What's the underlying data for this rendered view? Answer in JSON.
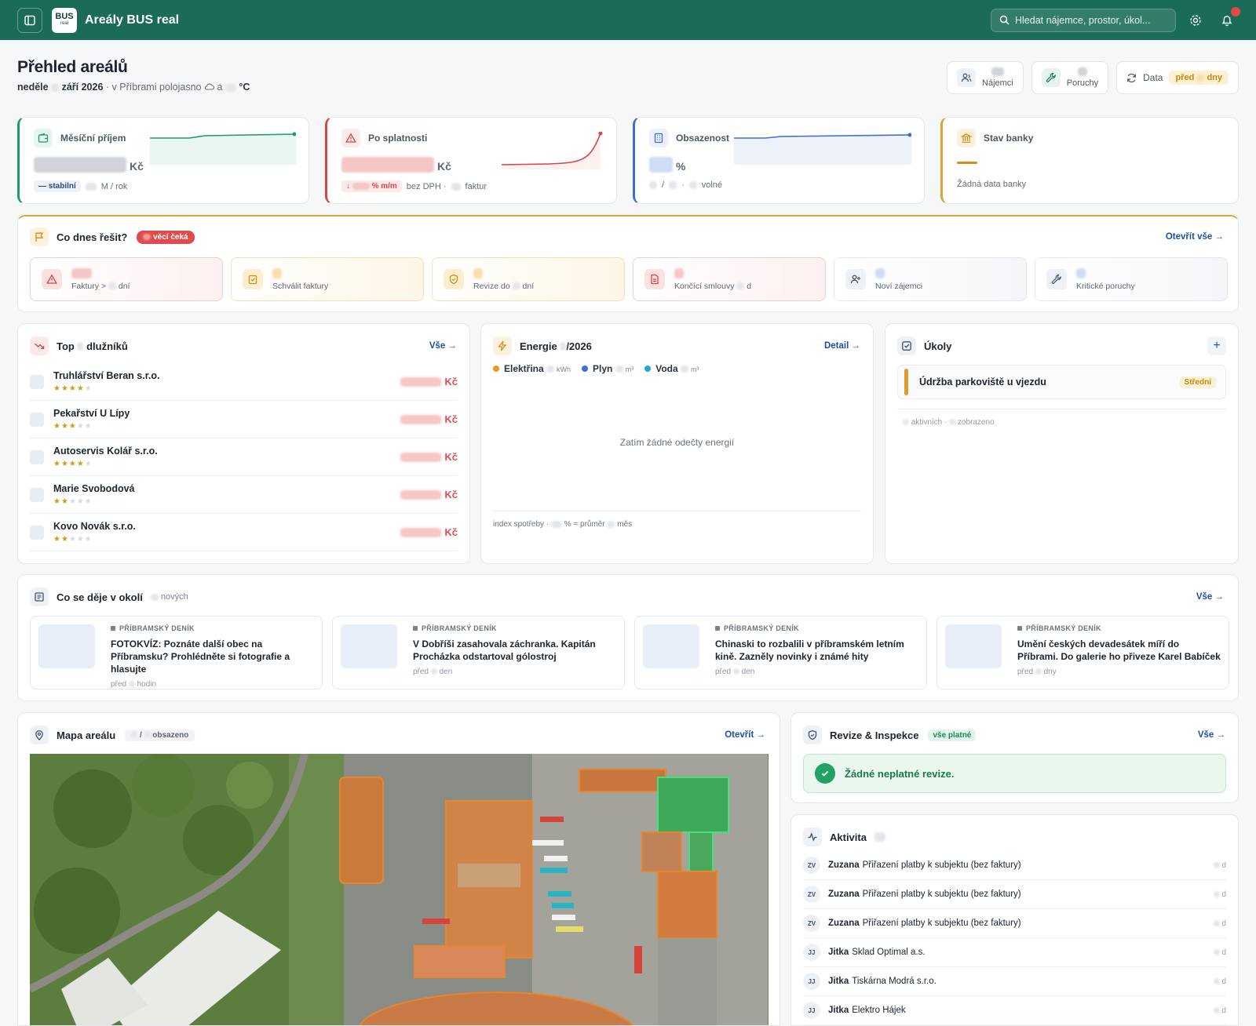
{
  "app": {
    "title": "Areály BUS real",
    "logo_text": "BUS",
    "logo_sub": "real",
    "search_placeholder": "Hledat nájemce, prostor, úkol..."
  },
  "header": {
    "title": "Přehled areálů",
    "date_day": "neděle",
    "date_month": "září 2026",
    "weather_pre": "· v Příbrami polojasno",
    "weather_mid": "a",
    "weather_unit": "°C"
  },
  "chips": {
    "tenants": "Nájemci",
    "faults": "Poruchy",
    "data_label": "Data",
    "data_pill_a": "před",
    "data_pill_b": "dny"
  },
  "kpis": {
    "income": {
      "label": "Měsíční příjem",
      "unit": "Kč",
      "badge": "stabilní",
      "foot": "M / rok"
    },
    "overdue": {
      "label": "Po splatnosti",
      "unit": "Kč",
      "badge": "% m/m",
      "foot_a": "bez DPH ·",
      "foot_b": "faktur"
    },
    "occupancy": {
      "label": "Obsazenost",
      "unit": "%",
      "foot_a": "/",
      "foot_b": "·",
      "foot_c": "volné"
    },
    "bank": {
      "label": "Stav banky",
      "foot": "Žádná data banky"
    }
  },
  "today": {
    "title": "Co dnes řešit?",
    "badge": "věcí čeká",
    "open_all": "Otevřít vše",
    "tiles": [
      {
        "a": "Faktury >",
        "b": "dní"
      },
      {
        "a": "Schválit faktury",
        "b": ""
      },
      {
        "a": "Revize do",
        "b": "dní"
      },
      {
        "a": "Končící smlouvy",
        "b": "d"
      },
      {
        "a": "Noví zájemci",
        "b": ""
      },
      {
        "a": "Kritické poruchy",
        "b": ""
      }
    ]
  },
  "debtors": {
    "title_a": "Top",
    "title_b": "dlužníků",
    "all": "Vše",
    "currency": "Kč",
    "items": [
      {
        "name": "Truhlářství Beran s.r.o.",
        "stars": 4
      },
      {
        "name": "Pekařství U Lípy",
        "stars": 3
      },
      {
        "name": "Autoservis Kolář s.r.o.",
        "stars": 4
      },
      {
        "name": "Marie Svobodová",
        "stars": 2
      },
      {
        "name": "Kovo Novák s.r.o.",
        "stars": 2
      }
    ]
  },
  "energy": {
    "title_a": "Energie",
    "title_b": "/2026",
    "detail": "Detail",
    "legend": [
      {
        "name": "Elektřina",
        "unit": "kWh",
        "color": "#e59a26"
      },
      {
        "name": "Plyn",
        "unit": "m³",
        "color": "#3c6fd1"
      },
      {
        "name": "Voda",
        "unit": "m³",
        "color": "#2aa6c9"
      }
    ],
    "empty": "Zatím žádné odečty energií",
    "foot_a": "index spotřeby ·",
    "foot_b": "% = průměr",
    "foot_c": "měs"
  },
  "tasks": {
    "title": "Úkoly",
    "item": "Údržba parkoviště u vjezdu",
    "priority": "Střední",
    "foot_a": "aktivních ·",
    "foot_b": "zobrazeno"
  },
  "news": {
    "title": "Co se děje v okolí",
    "count": "nových",
    "all": "Vše",
    "items": [
      {
        "source": "PŘÍBRAMSKÝ DENÍK",
        "headline": "FOTOKVÍZ: Poznáte další obec na Příbramsku? Prohlédněte si fotografie a hlasujte",
        "t1": "před",
        "t2": "hodin"
      },
      {
        "source": "PŘÍBRAMSKÝ DENÍK",
        "headline": "V Dobříši zasahovala záchranka. Kapitán Procházka odstartoval gólostroj",
        "t1": "před",
        "t2": "den"
      },
      {
        "source": "PŘÍBRAMSKÝ DENÍK",
        "headline": "Chinaski to rozbalili v příbramském letním kině. Zazněly novinky i známé hity",
        "t1": "před",
        "t2": "den"
      },
      {
        "source": "PŘÍBRAMSKÝ DENÍK",
        "headline": "Umění českých devadesátek míří do Příbrami. Do galerie ho přiveze Karel Babíček",
        "t1": "před",
        "t2": "dny"
      }
    ]
  },
  "map": {
    "title": "Mapa areálu",
    "sep": "/",
    "occupied": "obsazeno",
    "open": "Otevřít"
  },
  "revisions": {
    "title": "Revize & Inspekce",
    "badge": "vše platné",
    "all": "Vše",
    "ok": "Žádné neplatné revize."
  },
  "activity": {
    "title": "Aktivita",
    "items": [
      {
        "av": "ZV",
        "user": "Zuzana",
        "text": "Přiřazení platby k subjektu (bez faktury)",
        "d": "d"
      },
      {
        "av": "ZV",
        "user": "Zuzana",
        "text": "Přiřazení platby k subjektu (bez faktury)",
        "d": "d"
      },
      {
        "av": "ZV",
        "user": "Zuzana",
        "text": "Přiřazení platby k subjektu (bez faktury)",
        "d": "d"
      },
      {
        "av": "JJ",
        "user": "Jitka",
        "text": "Sklad Optimal a.s.",
        "d": "d"
      },
      {
        "av": "JJ",
        "user": "Jitka",
        "text": "Tiskárna Modrá s.r.o.",
        "d": "d"
      },
      {
        "av": "JJ",
        "user": "Jitka",
        "text": "Elektro Hájek",
        "d": "d"
      }
    ]
  }
}
